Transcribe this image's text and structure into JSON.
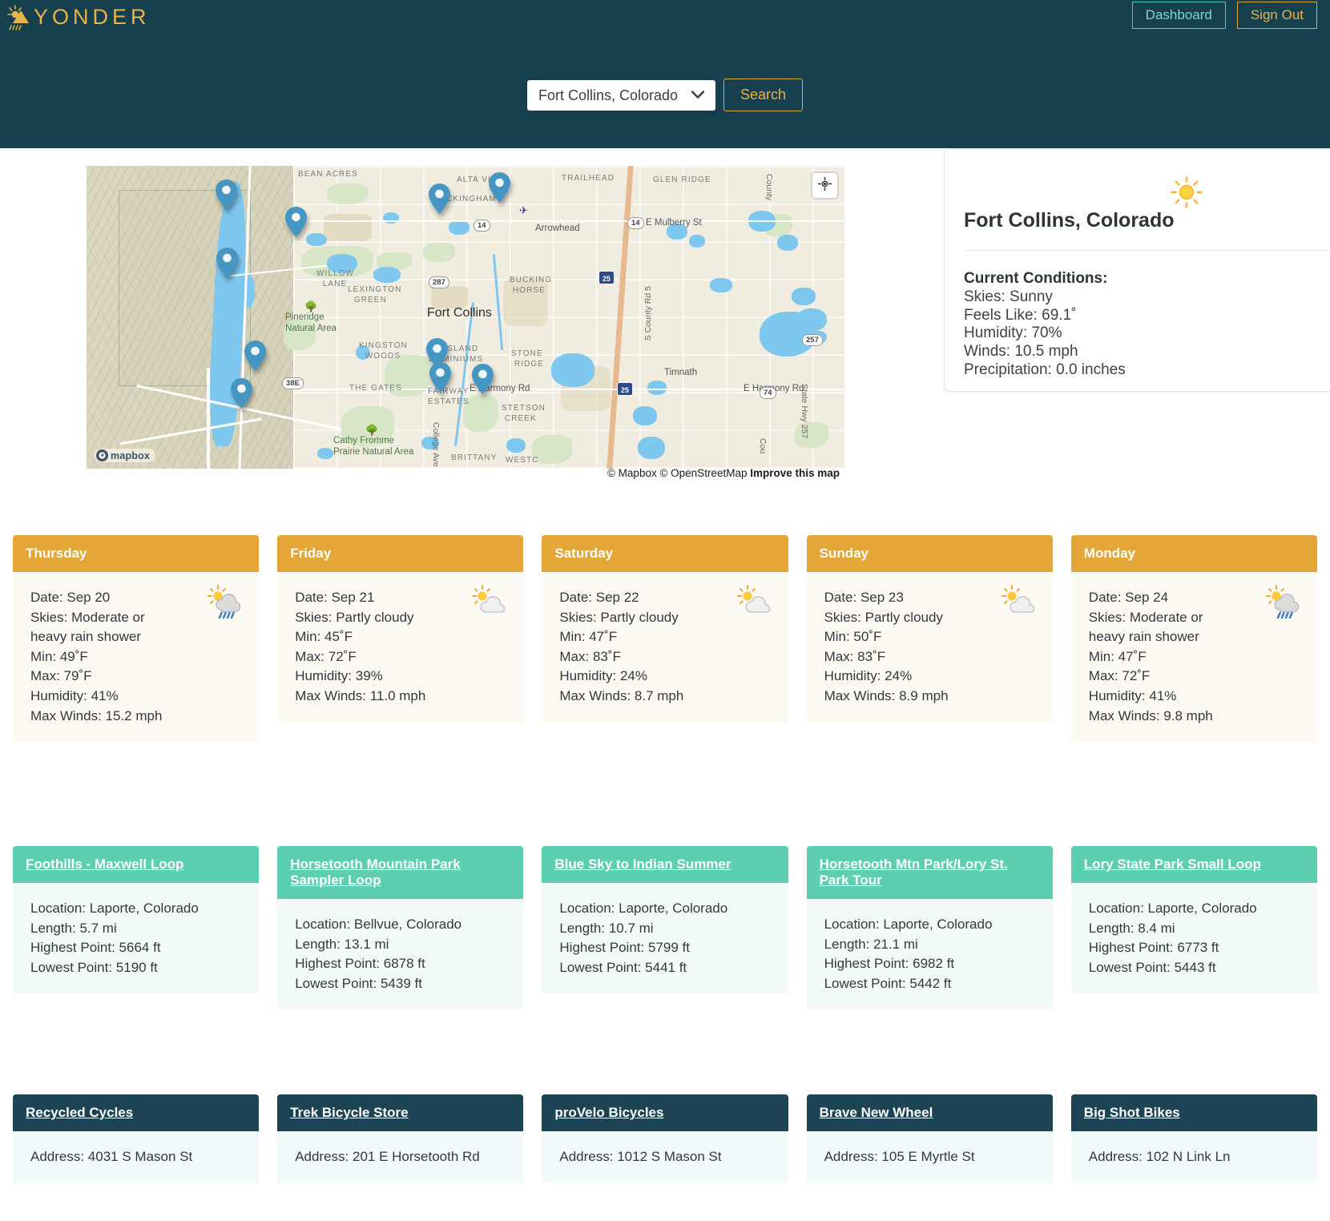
{
  "header": {
    "brand": "YONDER",
    "brand_icon": "sun-rain-icon",
    "dashboard_label": "Dashboard",
    "signout_label": "Sign Out",
    "accent_teal": "#4ecdc4",
    "accent_gold": "#e8b348",
    "bg": "#16404d"
  },
  "search": {
    "selected_city": "Fort Collins, Colorado",
    "options": [
      "Fort Collins, Colorado"
    ],
    "button_label": "Search",
    "dropdown_icon": "chevron-down-icon"
  },
  "map": {
    "city_label": "Fort Collins",
    "geolocate_icon": "crosshair-icon",
    "logo_text": "mapbox",
    "attribution": "© Mapbox © OpenStreetMap ",
    "attribution_link": "Improve this map",
    "place_labels": [
      "BEAN ACRES",
      "ALTA VISTA",
      "TRAILHEAD",
      "GLEN RIDGE",
      "BUCKINGHAM",
      "Arrowhead",
      "E Mulberry St",
      "WILLOW LANE",
      "LEXINGTON GREEN",
      "BUCKING HORSE",
      "KINGSTON WOODS",
      "Pineridge Natural Area",
      "STONE RIDGE",
      "THE GATES",
      "VE ISLAND DOMINIUMS",
      "FAIRWAY ESTATES",
      "E Harmony Rd",
      "Timnath",
      "STETSON CREEK",
      "Cathy Fromme Prairie Natural Area",
      "BRITTANY",
      "WESTC",
      "College Ave",
      "S County Rd 5",
      "County",
      "State Hwy 257"
    ],
    "route_shields": [
      "14",
      "14",
      "287",
      "38E",
      "257",
      "74",
      "25",
      "25"
    ],
    "marker_count": 10
  },
  "current_weather": {
    "title": "Fort Collins, Colorado",
    "icon": "sunny-icon",
    "heading": "Current Conditions:",
    "lines": [
      "Skies: Sunny",
      "Feels Like: 69.1˚",
      "Humidity: 70%",
      "Winds: 10.5 mph",
      "Precipitation: 0.0 inches"
    ]
  },
  "forecast": [
    {
      "day": "Thursday",
      "icon": "sun-cloud-rain-icon",
      "lines": [
        "Date: Sep 20",
        "Skies: Moderate or heavy rain shower",
        "Min: 49˚F",
        "Max: 79˚F",
        "Humidity: 41%",
        "Max Winds: 15.2 mph"
      ]
    },
    {
      "day": "Friday",
      "icon": "sun-cloud-icon",
      "lines": [
        "Date: Sep 21",
        "Skies: Partly cloudy",
        "Min: 45˚F",
        "Max: 72˚F",
        "Humidity: 39%",
        "Max Winds: 11.0 mph"
      ]
    },
    {
      "day": "Saturday",
      "icon": "sun-cloud-icon",
      "lines": [
        "Date: Sep 22",
        "Skies: Partly cloudy",
        "Min: 47˚F",
        "Max: 83˚F",
        "Humidity: 24%",
        "Max Winds: 8.7 mph"
      ]
    },
    {
      "day": "Sunday",
      "icon": "sun-cloud-icon",
      "lines": [
        "Date: Sep 23",
        "Skies: Partly cloudy",
        "Min: 50˚F",
        "Max: 83˚F",
        "Humidity: 24%",
        "Max Winds: 8.9 mph"
      ]
    },
    {
      "day": "Monday",
      "icon": "sun-cloud-rain-icon",
      "lines": [
        "Date: Sep 24",
        "Skies: Moderate or heavy rain shower",
        "Min: 47˚F",
        "Max: 72˚F",
        "Humidity: 41%",
        "Max Winds: 9.8 mph"
      ]
    }
  ],
  "trails": [
    {
      "name": "Foothills - Maxwell Loop",
      "lines": [
        "Location: Laporte, Colorado",
        "Length: 5.7 mi",
        "Highest Point: 5664 ft",
        "Lowest Point: 5190 ft"
      ]
    },
    {
      "name": "Horsetooth Mountain Park Sampler Loop",
      "lines": [
        "Location: Bellvue, Colorado",
        "Length: 13.1 mi",
        "Highest Point: 6878 ft",
        "Lowest Point: 5439 ft"
      ]
    },
    {
      "name": "Blue Sky to Indian Summer",
      "lines": [
        "Location: Laporte, Colorado",
        "Length: 10.7 mi",
        "Highest Point: 5799 ft",
        "Lowest Point: 5441 ft"
      ]
    },
    {
      "name": "Horsetooth Mtn Park/Lory St. Park Tour",
      "lines": [
        "Location: Laporte, Colorado",
        "Length: 21.1 mi",
        "Highest Point: 6982 ft",
        "Lowest Point: 5442 ft"
      ]
    },
    {
      "name": "Lory State Park Small Loop",
      "lines": [
        "Location: Laporte, Colorado",
        "Length: 8.4 mi",
        "Highest Point: 6773 ft",
        "Lowest Point: 5443 ft"
      ]
    }
  ],
  "shops": [
    {
      "name": "Recycled Cycles",
      "lines": [
        "Address: 4031 S Mason St"
      ]
    },
    {
      "name": "Trek Bicycle Store",
      "lines": [
        "Address: 201 E Horsetooth Rd"
      ]
    },
    {
      "name": "proVelo Bicycles",
      "lines": [
        "Address: 1012 S Mason St"
      ]
    },
    {
      "name": "Brave New Wheel",
      "lines": [
        "Address: 105 E Myrtle St"
      ]
    },
    {
      "name": "Big Shot Bikes",
      "lines": [
        "Address: 102 N Link Ln"
      ]
    }
  ]
}
